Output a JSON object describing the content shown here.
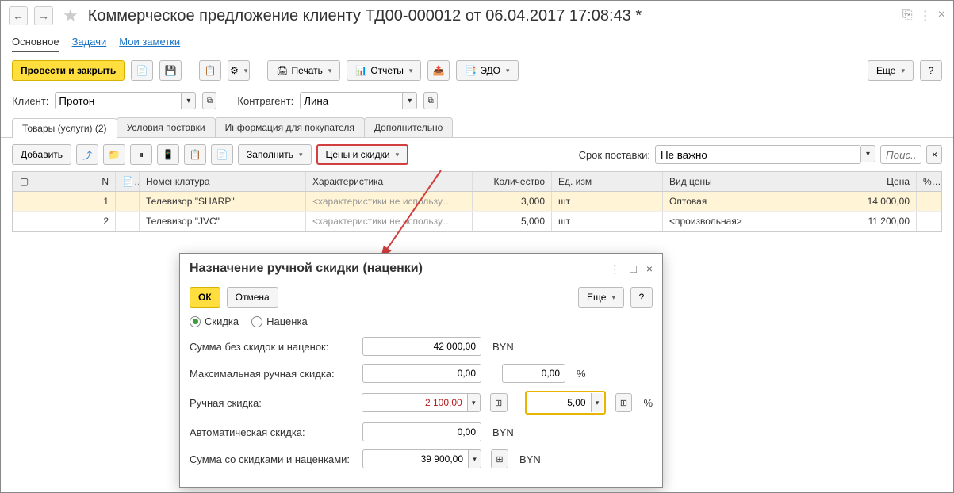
{
  "title": "Коммерческое предложение клиенту ТД00-000012 от 06.04.2017 17:08:43 *",
  "nav": {
    "main": "Основное",
    "tasks": "Задачи",
    "notes": "Мои заметки"
  },
  "toolbar": {
    "post_close": "Провести и закрыть",
    "print": "Печать",
    "reports": "Отчеты",
    "edo": "ЭДО",
    "more": "Еще"
  },
  "fields": {
    "client_label": "Клиент:",
    "client_value": "Протон",
    "counterparty_label": "Контрагент:",
    "counterparty_value": "Лина"
  },
  "doc_tabs": {
    "goods": "Товары (услуги) (2)",
    "delivery": "Условия поставки",
    "buyer_info": "Информация для покупателя",
    "extra": "Дополнительно"
  },
  "table_toolbar": {
    "add": "Добавить",
    "fill": "Заполнить",
    "prices": "Цены и скидки",
    "srok_label": "Срок поставки:",
    "srok_value": "Не важно",
    "search_ph": "Поис..."
  },
  "grid": {
    "headers": {
      "n": "N",
      "nom": "Номенклатура",
      "char": "Характеристика",
      "qty": "Количество",
      "unit": "Ед. изм",
      "ptype": "Вид цены",
      "price": "Цена",
      "disc": "% ав"
    },
    "rows": [
      {
        "n": "1",
        "nom": "Телевизор \"SHARP\"",
        "char": "<характеристики не использу…",
        "qty": "3,000",
        "unit": "шт",
        "ptype": "Оптовая",
        "price": "14 000,00"
      },
      {
        "n": "2",
        "nom": "Телевизор \"JVC\"",
        "char": "<характеристики не использу…",
        "qty": "5,000",
        "unit": "шт",
        "ptype": "<произвольная>",
        "price": "11 200,00"
      }
    ]
  },
  "modal": {
    "title": "Назначение ручной скидки (наценки)",
    "ok": "ОК",
    "cancel": "Отмена",
    "more": "Еще",
    "radio_discount": "Скидка",
    "radio_markup": "Наценка",
    "sum_no_disc_label": "Сумма без скидок и наценок:",
    "sum_no_disc_val": "42 000,00",
    "max_disc_label": "Максимальная ручная скидка:",
    "max_disc_val": "0,00",
    "max_disc_pct": "0,00",
    "manual_disc_label": "Ручная скидка:",
    "manual_disc_val": "2 100,00",
    "manual_disc_pct": "5,00",
    "auto_disc_label": "Автоматическая скидка:",
    "auto_disc_val": "0,00",
    "sum_with_label": "Сумма со скидками и наценками:",
    "sum_with_val": "39 900,00",
    "currency": "BYN",
    "percent": "%"
  }
}
